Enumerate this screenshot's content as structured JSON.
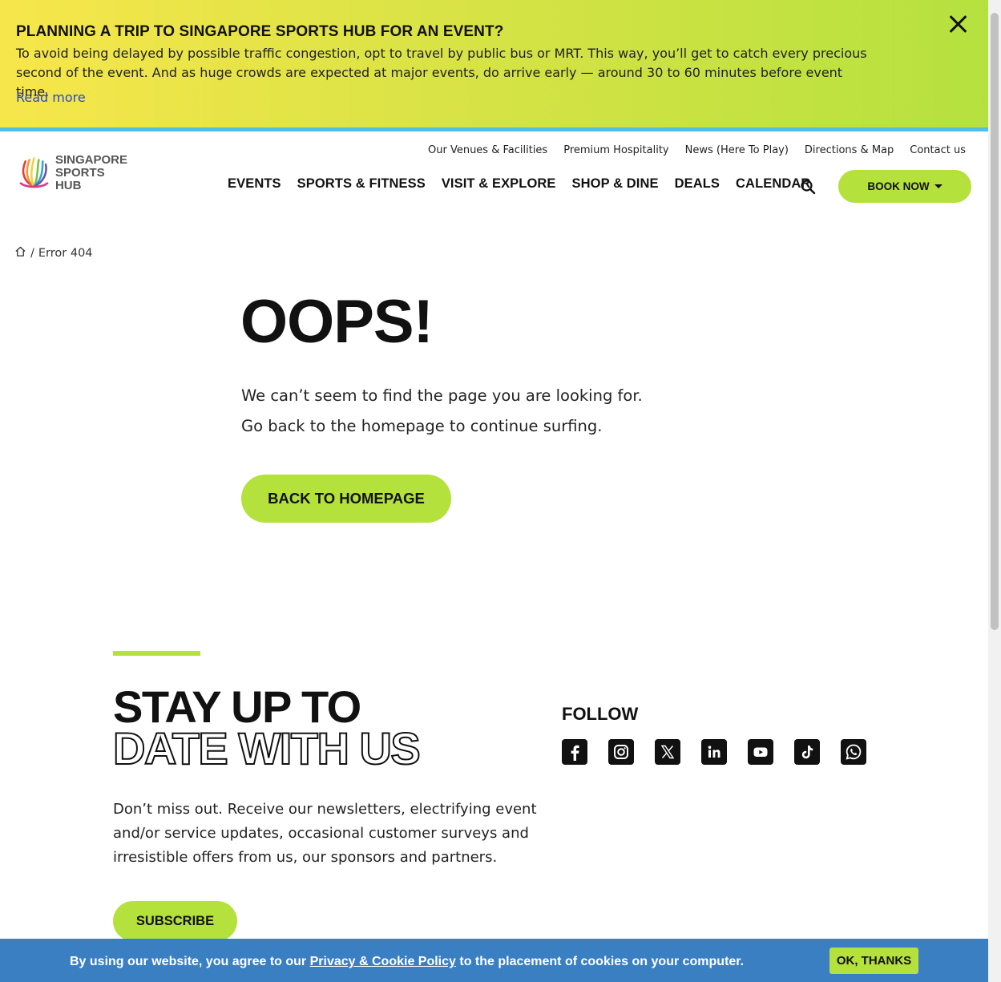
{
  "notice": {
    "title": "PLANNING A TRIP TO SINGAPORE SPORTS HUB FOR AN EVENT?",
    "text": "To avoid being delayed by possible traffic congestion, opt to travel by public bus or MRT. This way, you’ll get to catch every precious second of the event. And as huge crowds are expected at major events, do arrive early — around 30 to 60 minutes before event time.",
    "link": "Read more",
    "close_icon": "close-icon",
    "colors": {
      "gradient_start": "#f7e64b",
      "gradient_end": "#b5e13f",
      "rule": "#4dbfe8",
      "link": "#2848d8"
    }
  },
  "header": {
    "logo_line1": "SINGAPORE",
    "logo_line2": "SPORTS HUB",
    "util_nav": [
      "Our Venues & Facilities",
      "Premium Hospitality",
      "News (Here To Play)",
      "Directions & Map",
      "Contact us"
    ],
    "main_nav": [
      "EVENTS",
      "SPORTS & FITNESS",
      "VISIT & EXPLORE",
      "SHOP & DINE",
      "DEALS",
      "CALENDAR"
    ],
    "search_icon": "search-icon",
    "book_label": "BOOK NOW",
    "accent": "#b4e13c"
  },
  "breadcrumb": {
    "home_icon": "home-icon",
    "separator": "/",
    "current": "Error 404"
  },
  "error": {
    "title": "OOPS!",
    "line1": "We can’t seem to find the page you are looking for.",
    "line2": "Go back to the homepage to continue surfing.",
    "button": "BACK TO HOMEPAGE"
  },
  "newsletter": {
    "heading_line1": "STAY UP TO",
    "heading_line2": "DATE WITH US",
    "text": "Don’t miss out. Receive our newsletters, electrifying event and/or service updates, occasional customer surveys and irresistible offers from us, our sponsors and partners.",
    "button": "SUBSCRIBE"
  },
  "follow": {
    "title": "FOLLOW",
    "icons": [
      "facebook-icon",
      "instagram-icon",
      "x-icon",
      "linkedin-icon",
      "youtube-icon",
      "tiktok-icon",
      "whatsapp-icon"
    ]
  },
  "cookie": {
    "text_before": "By using our website, you agree to our ",
    "link": "Privacy & Cookie Policy",
    "text_after": " to the placement of cookies on your computer.",
    "button": "OK, THANKS",
    "background": "#3a7fc2"
  }
}
